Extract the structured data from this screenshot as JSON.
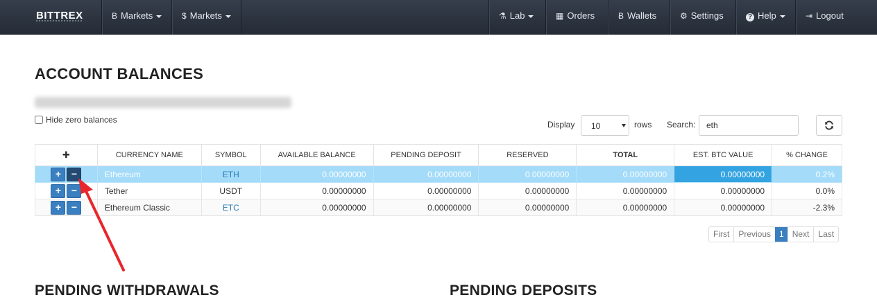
{
  "navbar": {
    "brand": "BITTREX",
    "left_items": [
      {
        "icon": "bitcoin-icon",
        "glyph": "Ƀ",
        "label": "Markets"
      },
      {
        "icon": "dollar-icon",
        "glyph": "$",
        "label": "Markets"
      }
    ],
    "right_items": [
      {
        "icon": "flask-icon",
        "glyph": "⚗",
        "label": "Lab"
      },
      {
        "icon": "calendar-icon",
        "glyph": "▦",
        "label": "Orders"
      },
      {
        "icon": "bitcoin-icon",
        "glyph": "Ƀ",
        "label": "Wallets"
      },
      {
        "icon": "gear-icon",
        "glyph": "⚙",
        "label": "Settings"
      },
      {
        "icon": "help-icon",
        "glyph": "?",
        "label": "Help"
      },
      {
        "icon": "logout-icon",
        "glyph": "⇥",
        "label": "Logout"
      }
    ]
  },
  "page": {
    "title": "ACCOUNT BALANCES",
    "hide_zero_label": "Hide zero balances"
  },
  "controls": {
    "display_label": "Display",
    "display_value": "10",
    "rows_label": "rows",
    "search_label": "Search:",
    "search_value": "eth"
  },
  "table": {
    "ctrl_header": "✚",
    "headers": [
      "CURRENCY NAME",
      "SYMBOL",
      "AVAILABLE BALANCE",
      "PENDING DEPOSIT",
      "RESERVED",
      "TOTAL",
      "EST. BTC VALUE",
      "% CHANGE"
    ],
    "rows": [
      {
        "name": "Ethereum",
        "symbol": "ETH",
        "available": "0.00000000",
        "pending": "0.00000000",
        "reserved": "0.00000000",
        "total": "0.00000000",
        "btc": "0.00000000",
        "change": "0.2%"
      },
      {
        "name": "Tether",
        "symbol": "USDT",
        "available": "0.00000000",
        "pending": "0.00000000",
        "reserved": "0.00000000",
        "total": "0.00000000",
        "btc": "0.00000000",
        "change": "0.0%"
      },
      {
        "name": "Ethereum Classic",
        "symbol": "ETC",
        "available": "0.00000000",
        "pending": "0.00000000",
        "reserved": "0.00000000",
        "total": "0.00000000",
        "btc": "0.00000000",
        "change": "-2.3%"
      }
    ]
  },
  "pagination": {
    "first": "First",
    "previous": "Previous",
    "current": "1",
    "next": "Next",
    "last": "Last"
  },
  "sections": {
    "withdrawals": "PENDING WITHDRAWALS",
    "deposits": "PENDING DEPOSITS"
  },
  "colors": {
    "navbar": "#2c3440",
    "accent": "#3a7fc0",
    "selected_row": "#a3dbf9",
    "annotation_arrow": "#e8262b"
  }
}
